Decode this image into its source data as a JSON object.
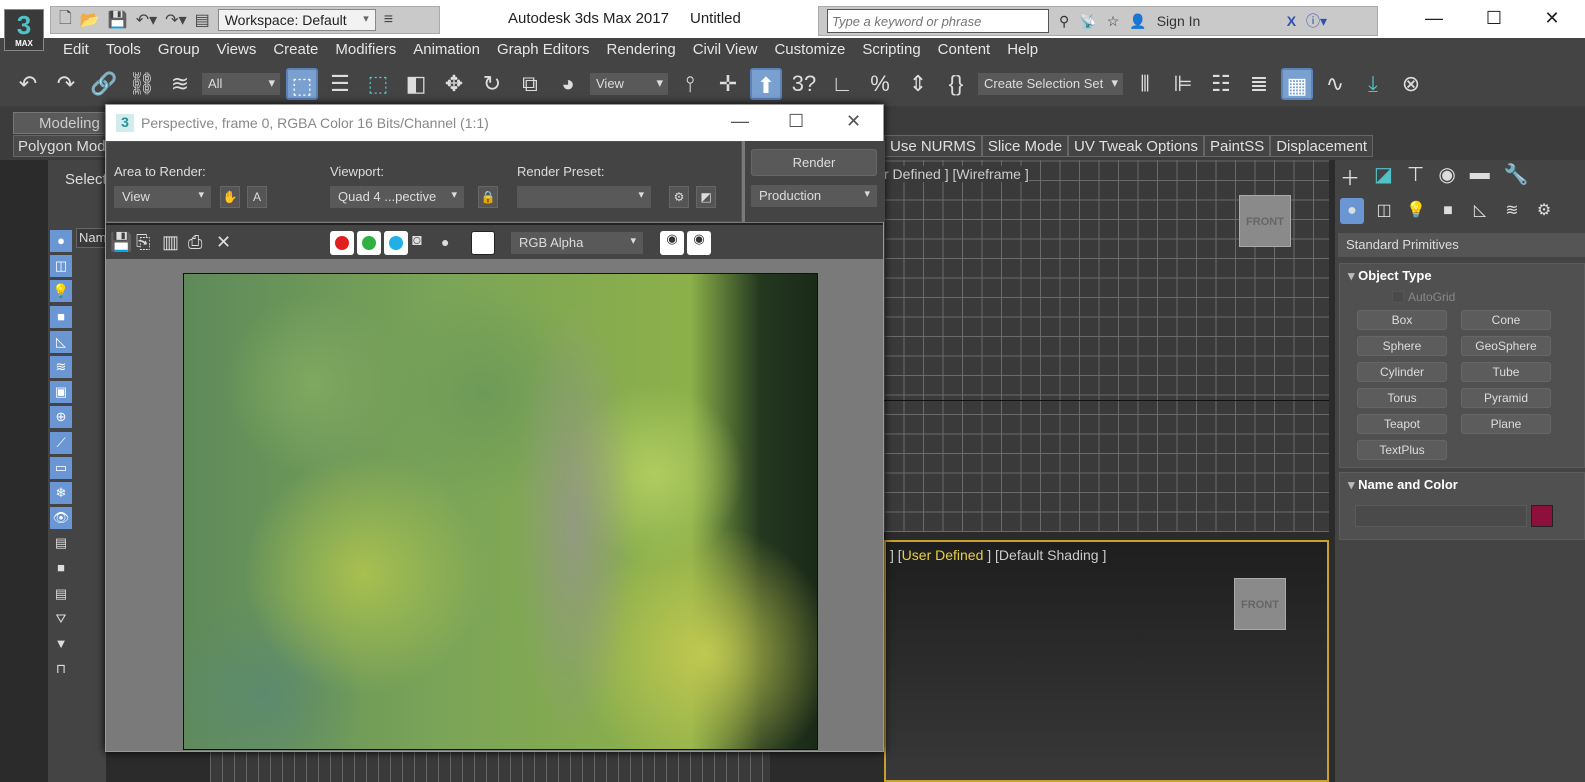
{
  "app": {
    "logo_text": "3",
    "logo_sub": "MAX",
    "title": "Autodesk 3ds Max 2017",
    "file": "Untitled",
    "workspace": "Workspace: Default"
  },
  "infocenter": {
    "search_placeholder": "Type a keyword or phrase",
    "sign_in": "Sign In"
  },
  "menu": [
    "Edit",
    "Tools",
    "Group",
    "Views",
    "Create",
    "Modifiers",
    "Animation",
    "Graph Editors",
    "Rendering",
    "Civil View",
    "Customize",
    "Scripting",
    "Content",
    "Help"
  ],
  "toolbar": {
    "filter": "All",
    "ref_coord": "View",
    "selection_set": "Create Selection Set"
  },
  "ribbon": {
    "tab": "Modeling",
    "panel": "Polygon Modeling",
    "items": [
      "Use NURMS",
      "Slice Mode",
      "UV Tweak Options",
      "PaintSS",
      "Displacement"
    ]
  },
  "scene_explorer": {
    "select": "Select",
    "name_col": "Name"
  },
  "viewports": {
    "top_label": "r Defined ] [Wireframe ]",
    "cube": "FRONT",
    "bottom_label_pre": "] [",
    "bottom_label_user": "User Defined",
    "bottom_label_post": "] [Default Shading ]"
  },
  "command_panel": {
    "category": "Standard Primitives",
    "object_type": "Object Type",
    "autogrid": "AutoGrid",
    "buttons": [
      "Box",
      "Cone",
      "Sphere",
      "GeoSphere",
      "Cylinder",
      "Tube",
      "Torus",
      "Pyramid",
      "Teapot",
      "Plane",
      "TextPlus"
    ],
    "name_color": "Name and Color",
    "color": "#8c0f3c"
  },
  "render_window": {
    "title": "Perspective, frame 0, RGBA Color 16 Bits/Channel (1:1)",
    "area_label": "Area to Render:",
    "area_value": "View",
    "viewport_label": "Viewport:",
    "viewport_value": "Quad 4 ...pective",
    "preset_label": "Render Preset:",
    "preset_value": "",
    "render": "Render",
    "mode": "Production",
    "channel": "RGB Alpha"
  }
}
